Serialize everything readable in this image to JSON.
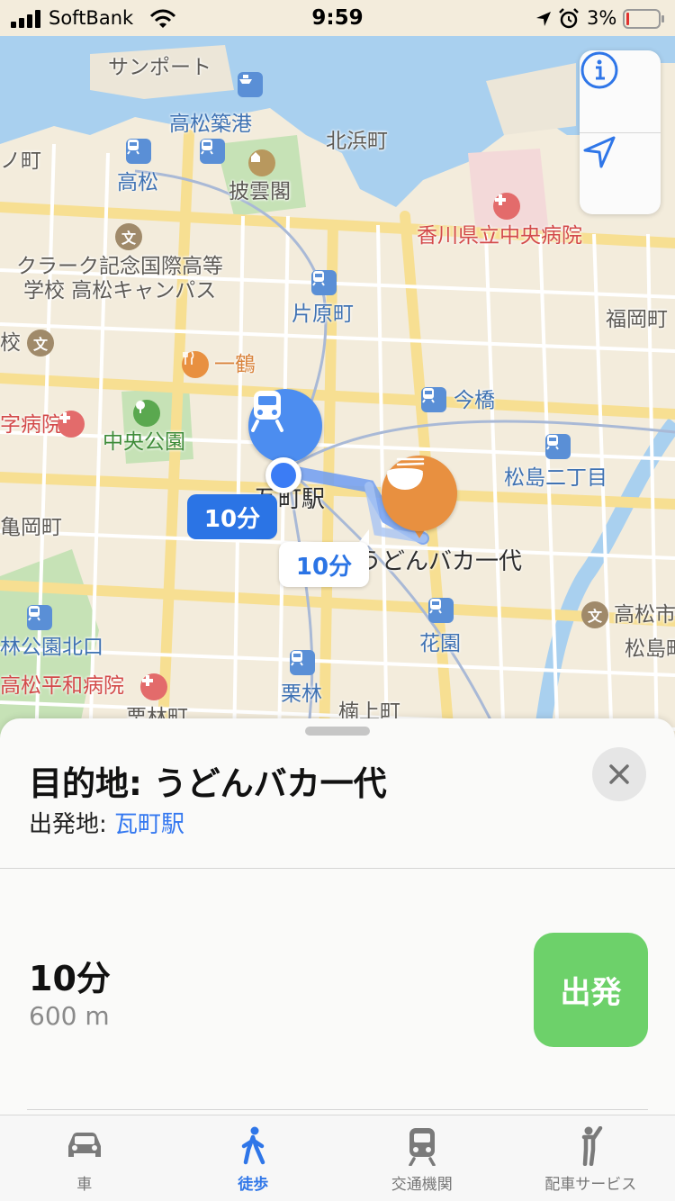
{
  "status_bar": {
    "carrier": "SoftBank",
    "time": "9:59",
    "battery_percent": "3%",
    "icons": [
      "signal-icon",
      "wifi-icon",
      "location-arrow-icon",
      "alarm-icon",
      "battery-icon"
    ]
  },
  "map": {
    "labels": {
      "sanport": "サンポート",
      "takamatsu_chikko": "高松築港",
      "kitahama": "北浜町",
      "machi_left": "ノ町",
      "takamatsu": "高松",
      "hiunkaku": "披雲閣",
      "kagawa_hospital": "香川県立中央病院",
      "clark_school_1": "クラーク記念国際高等",
      "clark_school_2": "学校 高松キャンパス",
      "kataharamachi": "片原町",
      "fukuokamachi": "福岡町",
      "kou": "校",
      "ichizuru": "一鶴",
      "imabashi": "今橋",
      "ji_hospital": "字病院",
      "chuo_koen": "中央公園",
      "matsushima_nichome": "松島二丁目",
      "kameokamachi": "亀岡町",
      "takamatsu_city": "高松市",
      "matsushima_right": "松島町",
      "rin_koen_kitaguchi": "林公園北口",
      "hanazono": "花園",
      "takamatsu_heiwa_hospital": "高松平和病院",
      "ritsurin": "栗林",
      "nagagami": "楠上町",
      "kurin_bottom": "栗林町"
    },
    "origin_station": "瓦町駅",
    "destination_name": "うどんバカ一代",
    "route_bubble_primary": "10分",
    "route_bubble_secondary": "10分",
    "controls": {
      "info": "info-icon",
      "locate": "location-arrow-icon"
    }
  },
  "sheet": {
    "title": "目的地: うどんバカ一代",
    "origin_prefix": "出発地: ",
    "origin_link": "瓦町駅",
    "route_time": "10分",
    "route_distance": "600 m",
    "go_label": "出発"
  },
  "tabs": [
    {
      "label": "車",
      "icon": "car-icon",
      "active": false
    },
    {
      "label": "徒歩",
      "icon": "walking-icon",
      "active": true
    },
    {
      "label": "交通機関",
      "icon": "train-icon",
      "active": false
    },
    {
      "label": "配車サービス",
      "icon": "ride-hailing-icon",
      "active": false
    }
  ],
  "colors": {
    "accent_blue": "#2b74e5",
    "go_green": "#6dd16a",
    "poi_orange": "#e89040",
    "station_blue": "#4c8df0"
  }
}
